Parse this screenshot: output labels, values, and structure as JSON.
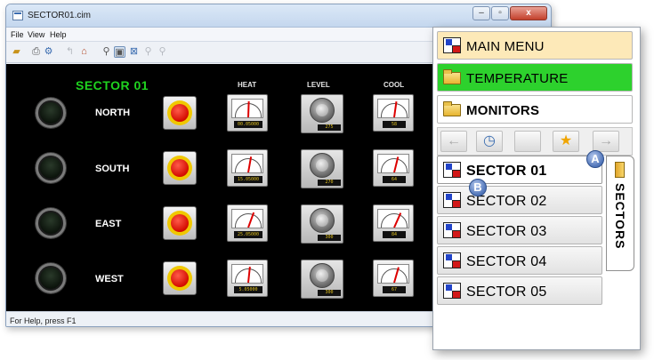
{
  "window": {
    "title": "SECTOR01.cim",
    "controls": {
      "minimize": "–",
      "maximize": "▫",
      "close": "x"
    }
  },
  "menu": [
    "File",
    "View",
    "Help"
  ],
  "status": "For Help, press F1",
  "hmi": {
    "title": "SECTOR 01",
    "columns": [
      "HEAT",
      "LEVEL",
      "COOL"
    ],
    "zones": [
      {
        "name": "NORTH",
        "heat_reading": "00.05000",
        "level_reading": "275",
        "cool_reading": "58"
      },
      {
        "name": "SOUTH",
        "heat_reading": "15.05000",
        "level_reading": "270",
        "cool_reading": "64"
      },
      {
        "name": "EAST",
        "heat_reading": "25.05000",
        "level_reading": "300",
        "cool_reading": "84"
      },
      {
        "name": "WEST",
        "heat_reading": "5.05000",
        "level_reading": "300",
        "cool_reading": "67"
      }
    ]
  },
  "nav": {
    "main_menu": "MAIN MENU",
    "temperature": "TEMPERATURE",
    "monitors": "MONITORS",
    "sectors_tab": "SECTORS",
    "sectors": [
      "SECTOR 01",
      "SECTOR 02",
      "SECTOR 03",
      "SECTOR 04",
      "SECTOR 05"
    ],
    "callouts": [
      "A",
      "B"
    ]
  },
  "colors": {
    "temperature_bg": "#2dd12d",
    "main_menu_bg": "#fde9b8",
    "sector_title": "#1fd31f"
  }
}
